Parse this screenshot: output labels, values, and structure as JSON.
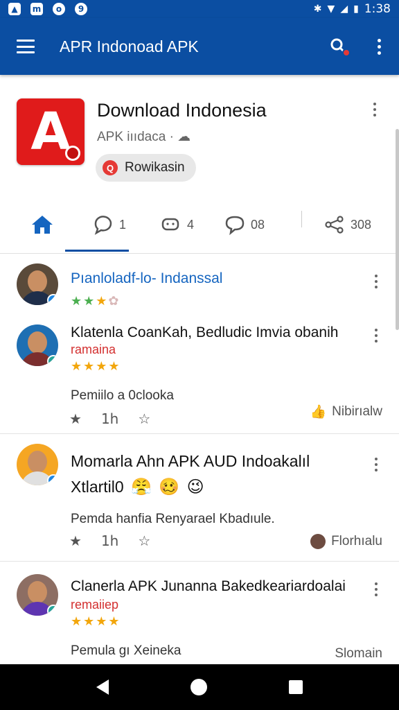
{
  "status_bar": {
    "time": "1:38",
    "left_icons": [
      "app-notification-icon",
      "mail-notification-icon",
      "chat-notification-icon",
      "app-notification-icon"
    ],
    "right_icons": [
      "bluetooth-icon",
      "wifi-icon",
      "cell-signal-icon",
      "battery-icon"
    ]
  },
  "app_bar": {
    "title": "APR Indonoad APK"
  },
  "app_header": {
    "name": "Download Indonesia",
    "subtitle": "APK iııdaca",
    "chip_label": "Rowikasin",
    "logo_letter": "A"
  },
  "tabs": [
    {
      "icon": "home-icon",
      "count": ""
    },
    {
      "icon": "comment-icon",
      "count": "1"
    },
    {
      "icon": "chat-bubbles-icon",
      "count": "4"
    },
    {
      "icon": "reply-icon",
      "count": "08"
    },
    {
      "icon": "share-icon",
      "count": "308"
    }
  ],
  "posts": [
    {
      "title": "Pıanloladf-lo- Indanssal",
      "rating_label": "",
      "body": ""
    },
    {
      "title": "Klatenla CoanKah, Bedludic Imvia obanih",
      "subtitle": "ramaina",
      "body": "Pemiilo a 0clooka",
      "actions": [
        "★",
        "1h",
        "☆"
      ],
      "meta_label": "Nibirıalw"
    },
    {
      "title_line1": "Momarla Ahn APK AUD Indoakalıl",
      "title_line2": "Xtlartil0",
      "body": "Pemda hanfia Renyarael Kbadıule.",
      "actions": [
        "★",
        "1h",
        "☆"
      ],
      "meta_label": "Florhıalu"
    },
    {
      "title": "Clanerla APK Junanna Bakedkeariardoalai",
      "subtitle": "remaiiep",
      "body": "Pemula gı Xeineka",
      "meta_label": "Slomain"
    }
  ],
  "colors": {
    "primary": "#0b4ea2",
    "accent": "#e01b1b",
    "star": "#f2a60c",
    "link": "#1565c0"
  }
}
